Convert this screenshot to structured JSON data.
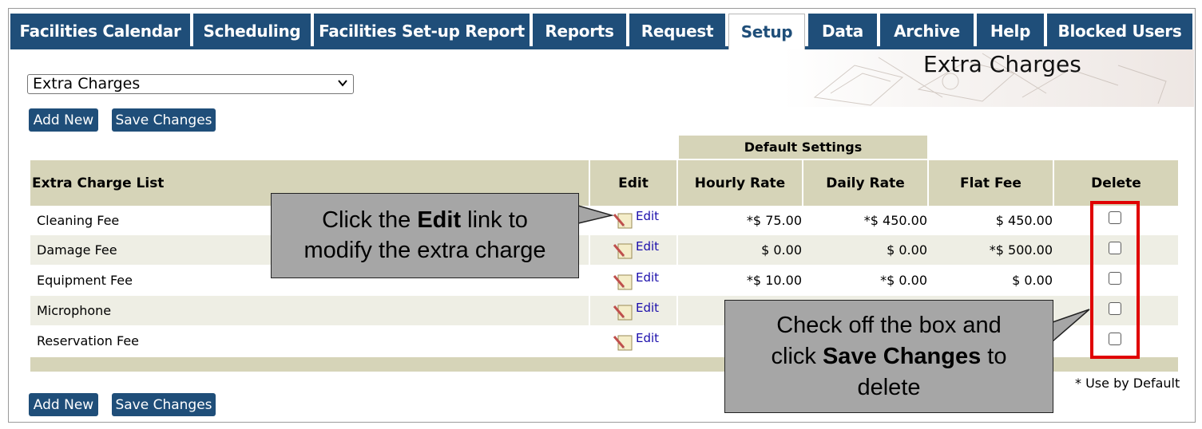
{
  "tabs": [
    {
      "label": "Facilities Calendar"
    },
    {
      "label": "Scheduling"
    },
    {
      "label": "Facilities Set-up Report"
    },
    {
      "label": "Reports"
    },
    {
      "label": "Request"
    },
    {
      "label": "Setup"
    },
    {
      "label": "Data"
    },
    {
      "label": "Archive"
    },
    {
      "label": "Help"
    },
    {
      "label": "Blocked Users"
    }
  ],
  "active_tab": "Setup",
  "page_title": "Extra Charges",
  "selector": {
    "value": "Extra Charges"
  },
  "buttons": {
    "add_new": "Add New",
    "save_changes": "Save Changes"
  },
  "table": {
    "group_header": "Default Settings",
    "headers": {
      "name": "Extra Charge List",
      "edit": "Edit",
      "hourly": "Hourly Rate",
      "daily": "Daily Rate",
      "flat": "Flat Fee",
      "delete": "Delete"
    },
    "edit_link": "Edit",
    "rows": [
      {
        "name": "Cleaning Fee",
        "hourly": "*$ 75.00",
        "daily": "*$ 450.00",
        "flat": "$ 450.00"
      },
      {
        "name": "Damage Fee",
        "hourly": "$ 0.00",
        "daily": "$ 0.00",
        "flat": "*$ 500.00"
      },
      {
        "name": "Equipment Fee",
        "hourly": "*$ 10.00",
        "daily": "*$ 0.00",
        "flat": "$ 0.00"
      },
      {
        "name": "Microphone",
        "hourly": "",
        "daily": "",
        "flat": ""
      },
      {
        "name": "Reservation Fee",
        "hourly": "",
        "daily": "",
        "flat": ""
      }
    ]
  },
  "default_note": "* Use by Default",
  "callouts": {
    "edit": {
      "pre": "Click the ",
      "bold": "Edit",
      "post1": " link to",
      "line2": "modify the extra charge"
    },
    "delete": {
      "line1": "Check off the box and",
      "pre2": "click ",
      "bold": "Save Changes",
      "post2": " to",
      "line3": "delete"
    }
  },
  "colors": {
    "brand": "#1f4e79",
    "header_bg": "#d6d4b8",
    "highlight": "#e00000",
    "callout_bg": "#a6a6a6"
  }
}
